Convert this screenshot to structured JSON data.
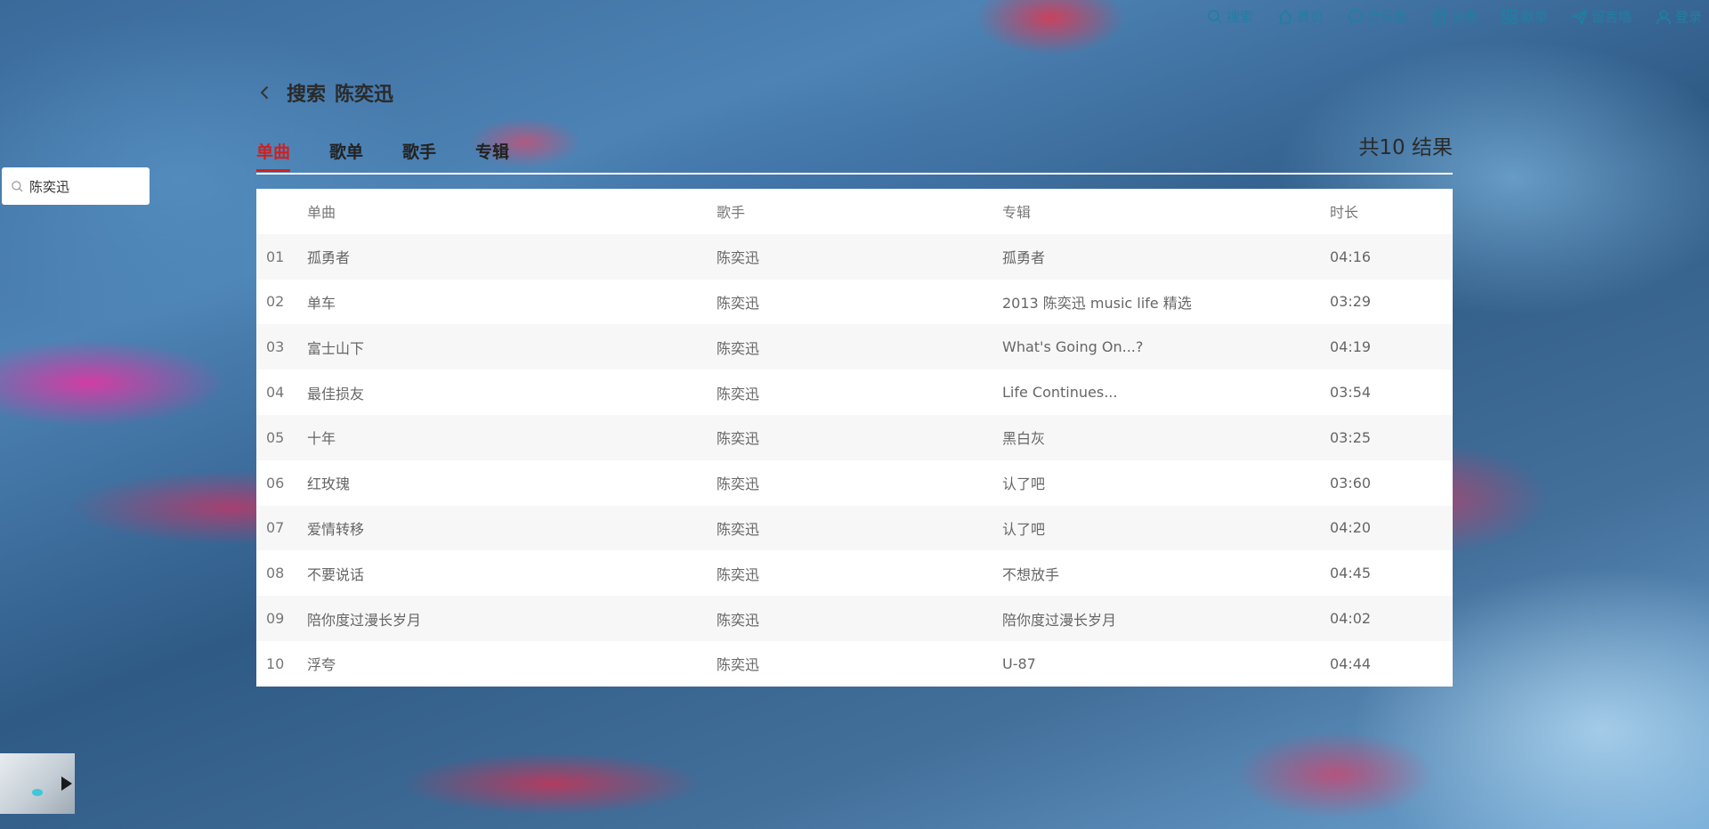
{
  "nav": {
    "items": [
      {
        "label": "搜索",
        "icon": "search-icon"
      },
      {
        "label": "首页",
        "icon": "home-icon"
      },
      {
        "label": "音乐盒",
        "icon": "chat-icon"
      },
      {
        "label": "分类",
        "icon": "document-icon"
      },
      {
        "label": "歌单",
        "icon": "grid-icon"
      },
      {
        "label": "留言墙",
        "icon": "send-icon"
      },
      {
        "label": "登录",
        "icon": "user-icon"
      }
    ],
    "color": "#1f7fa3"
  },
  "search": {
    "value": "陈奕迅",
    "placeholder": ""
  },
  "header": {
    "title_prefix": "搜索",
    "keyword": "陈奕迅",
    "result_count": "共10 结果"
  },
  "tabs": [
    {
      "label": "单曲",
      "active": true
    },
    {
      "label": "歌单",
      "active": false
    },
    {
      "label": "歌手",
      "active": false
    },
    {
      "label": "专辑",
      "active": false
    }
  ],
  "accent_color": "#d0201f",
  "table": {
    "columns": [
      "单曲",
      "歌手",
      "专辑",
      "时长"
    ],
    "rows": [
      {
        "index": "01",
        "title": "孤勇者",
        "artist": "陈奕迅",
        "album": "孤勇者",
        "duration": "04:16"
      },
      {
        "index": "02",
        "title": "单车",
        "artist": "陈奕迅",
        "album": "2013 陈奕迅 music life 精选",
        "duration": "03:29"
      },
      {
        "index": "03",
        "title": "富士山下",
        "artist": "陈奕迅",
        "album": "What's Going On...?",
        "duration": "04:19"
      },
      {
        "index": "04",
        "title": "最佳损友",
        "artist": "陈奕迅",
        "album": "Life Continues...",
        "duration": "03:54"
      },
      {
        "index": "05",
        "title": "十年",
        "artist": "陈奕迅",
        "album": "黑白灰",
        "duration": "03:25"
      },
      {
        "index": "06",
        "title": "红玫瑰",
        "artist": "陈奕迅",
        "album": "认了吧",
        "duration": "03:60"
      },
      {
        "index": "07",
        "title": "爱情转移",
        "artist": "陈奕迅",
        "album": "认了吧",
        "duration": "04:20"
      },
      {
        "index": "08",
        "title": "不要说话",
        "artist": "陈奕迅",
        "album": "不想放手",
        "duration": "04:45"
      },
      {
        "index": "09",
        "title": "陪你度过漫长岁月",
        "artist": "陈奕迅",
        "album": "陪你度过漫长岁月",
        "duration": "04:02"
      },
      {
        "index": "10",
        "title": "浮夸",
        "artist": "陈奕迅",
        "album": "U-87",
        "duration": "04:44"
      }
    ]
  },
  "player": {
    "icon": "play-icon"
  }
}
